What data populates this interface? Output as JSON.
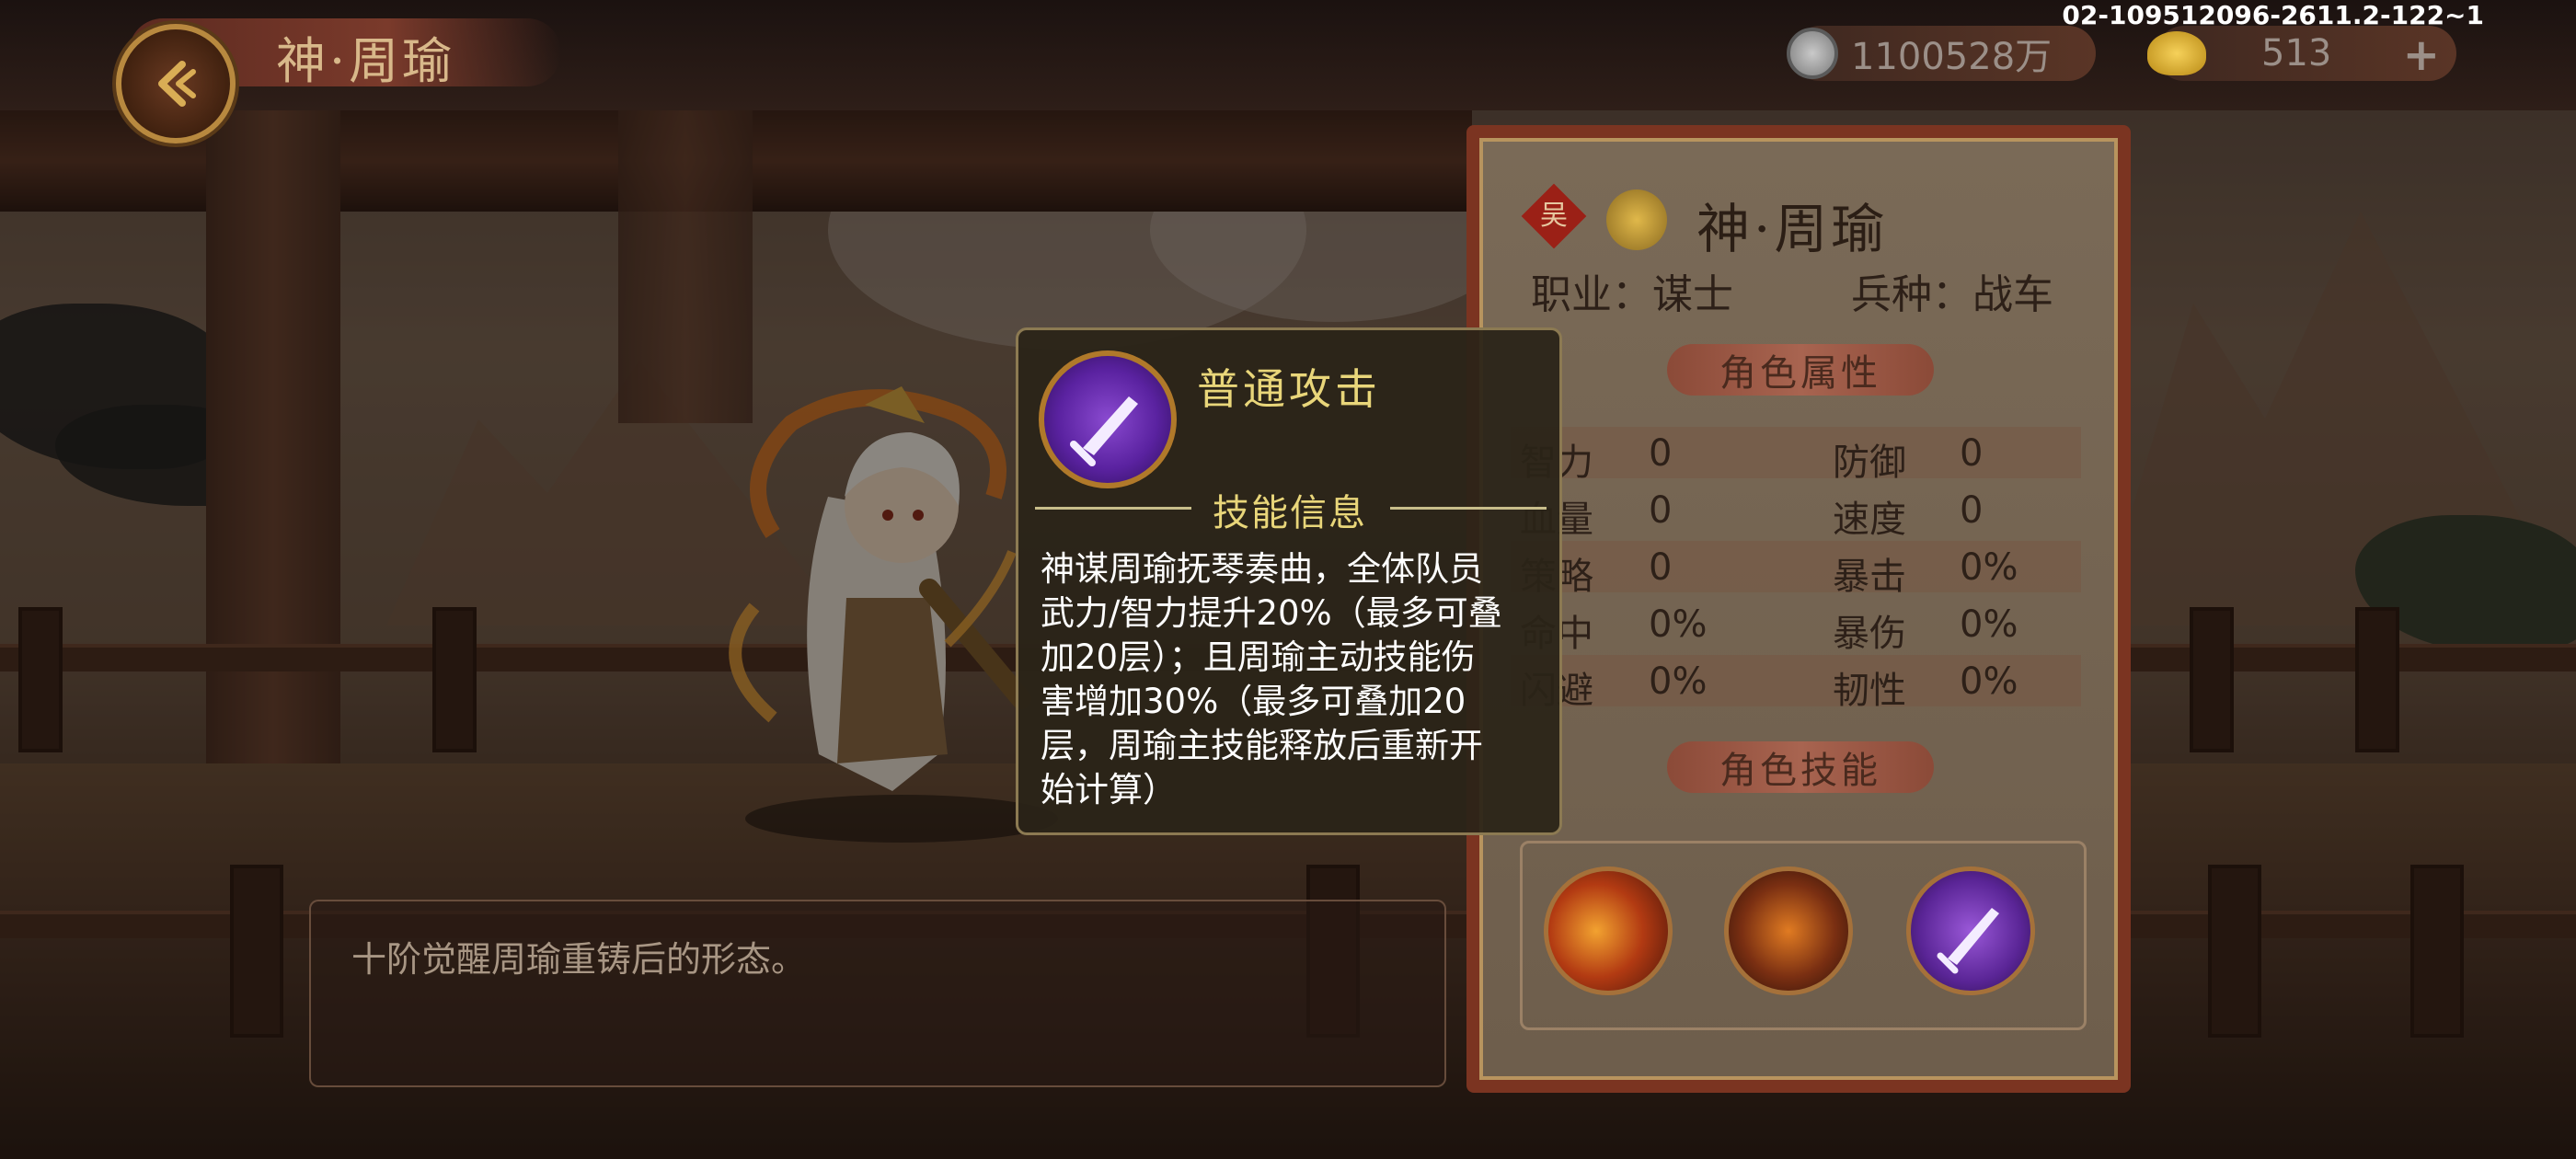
{
  "header": {
    "title": "神·周瑜",
    "currency": {
      "coins": "1100528万",
      "ingots": "513"
    },
    "version": "02-109512096-2611.2-122~1"
  },
  "description": "十阶觉醒周瑜重铸后的形态。",
  "panel": {
    "kingdom": "吴",
    "name": "神·周瑜",
    "profession_label": "职业：",
    "profession": "谋士",
    "troop_label": "兵种：",
    "troop": "战车",
    "attributes_title": "角色属性",
    "stats": [
      {
        "left_label": "智力",
        "left_value": "0",
        "right_label": "防御",
        "right_value": "0"
      },
      {
        "left_label": "血量",
        "left_value": "0",
        "right_label": "速度",
        "right_value": "0"
      },
      {
        "left_label": "策略",
        "left_value": "0",
        "right_label": "暴击",
        "right_value": "0%"
      },
      {
        "left_label": "命中",
        "left_value": "0%",
        "right_label": "暴伤",
        "right_value": "0%"
      },
      {
        "left_label": "闪避",
        "left_value": "0%",
        "right_label": "韧性",
        "right_value": "0%"
      }
    ],
    "skills_title": "角色技能",
    "skills": [
      "fire-skill-icon",
      "warrior-skill-icon",
      "sword-skill-icon"
    ]
  },
  "tooltip": {
    "skill_name": "普通攻击",
    "section": "技能信息",
    "lines": [
      "神谋周瑜抚琴奏曲，全体队员",
      "武力/智力提升20%（最多可叠",
      "加20层）；且周瑜主动技能伤",
      "害增加30%（最多可叠加20",
      "层，周瑜主技能释放后重新开",
      "始计算）"
    ]
  }
}
